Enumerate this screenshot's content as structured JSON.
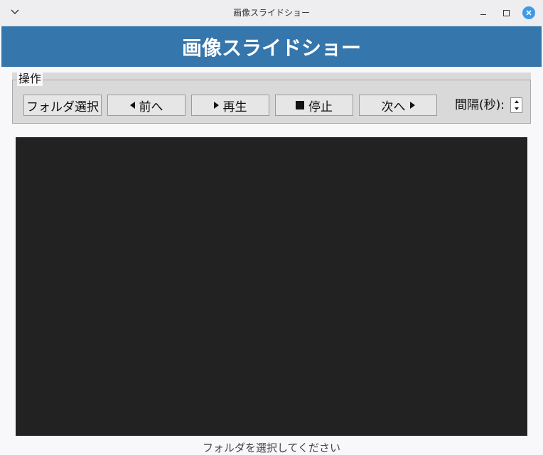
{
  "window": {
    "title": "画像スライドショー",
    "menu_icon": "chevron-down-icon",
    "controls": [
      "minimize-icon",
      "maximize-icon",
      "close-icon"
    ],
    "close_color": "#3d9ae8"
  },
  "header": {
    "title": "画像スライドショー",
    "bg_color": "#3576ad"
  },
  "controls_panel": {
    "legend": "操作",
    "buttons": {
      "folder": "フォルダ選択",
      "prev": "前へ",
      "play": "再生",
      "stop": "停止",
      "next": "次へ"
    },
    "interval_label": "間隔(秒):"
  },
  "viewer": {
    "bg_color": "#222222"
  },
  "status": {
    "text": "フォルダを選択してください"
  }
}
